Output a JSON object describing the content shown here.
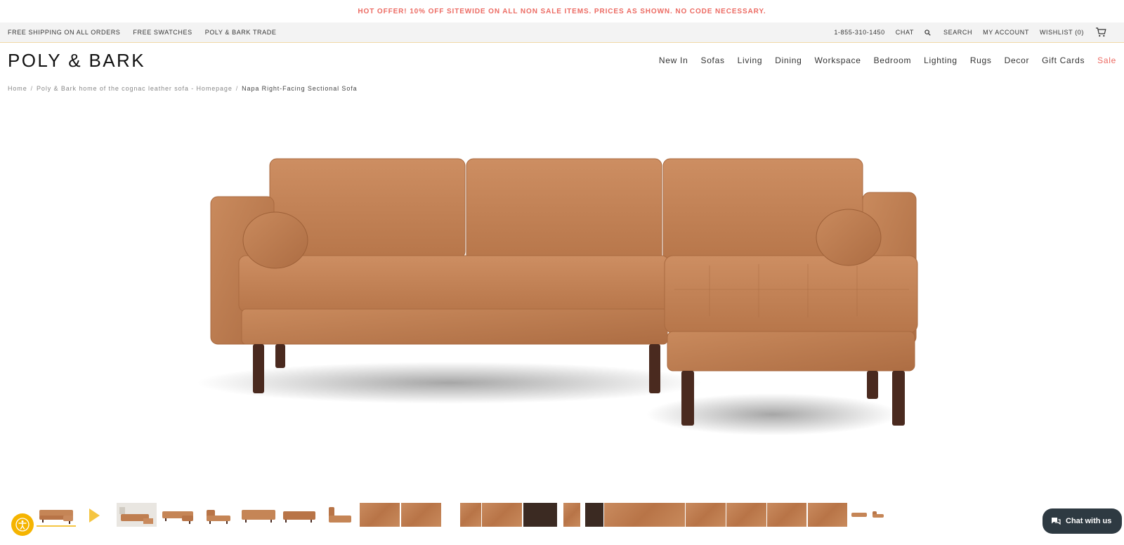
{
  "promo": {
    "text": "HOT OFFER! 10% OFF SITEWIDE ON ALL NON SALE ITEMS. PRICES AS SHOWN. NO CODE NECESSARY."
  },
  "utility": {
    "left": [
      "FREE SHIPPING ON ALL ORDERS",
      "FREE SWATCHES",
      "POLY & BARK TRADE"
    ],
    "phone": "1-855-310-1450",
    "chat": "CHAT",
    "search": "SEARCH",
    "account": "MY ACCOUNT",
    "wishlist": "WISHLIST (0)"
  },
  "header": {
    "logo": "POLY & BARK",
    "nav": [
      "New In",
      "Sofas",
      "Living",
      "Dining",
      "Workspace",
      "Bedroom",
      "Lighting",
      "Rugs",
      "Decor",
      "Gift Cards",
      "Sale"
    ]
  },
  "breadcrumb": {
    "items": [
      "Home",
      "Poly & Bark home of the cognac leather sofa - Homepage",
      "Napa Right-Facing Sectional Sofa"
    ]
  },
  "chat_widget": {
    "label": "Chat with us"
  },
  "colors": {
    "accent": "#ec6a62",
    "leather": "#c07e52",
    "wood": "#4a2a1f",
    "yellow": "#f5c542",
    "chat_bg": "#2e3a42"
  }
}
